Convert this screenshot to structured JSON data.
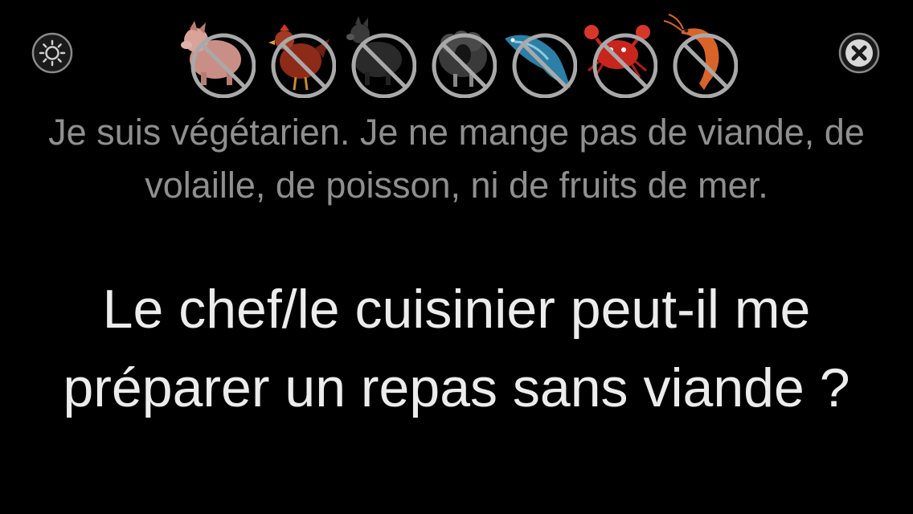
{
  "toolbar": {
    "left_icon": "sun-brightness-icon",
    "right_icon": "close-icon"
  },
  "restrictions": [
    {
      "icon": "no-pig-icon",
      "color": "#c98f86"
    },
    {
      "icon": "no-chicken-icon",
      "color": "#8d2a18"
    },
    {
      "icon": "no-boar-icon",
      "color": "#2a2a2a"
    },
    {
      "icon": "no-sheep-icon",
      "color": "#3a3a3a"
    },
    {
      "icon": "no-fish-icon",
      "color": "#2c7fa6"
    },
    {
      "icon": "no-crab-icon",
      "color": "#c8261c"
    },
    {
      "icon": "no-shrimp-icon",
      "color": "#d9642a"
    }
  ],
  "prohibition_color": "#a9a9a9",
  "statement": "Je suis végétarien. Je ne mange pas de viande, de volaille, de poisson, ni de fruits de mer.",
  "question": "Le chef/le cuisinier peut-il me préparer un repas sans viande ?"
}
